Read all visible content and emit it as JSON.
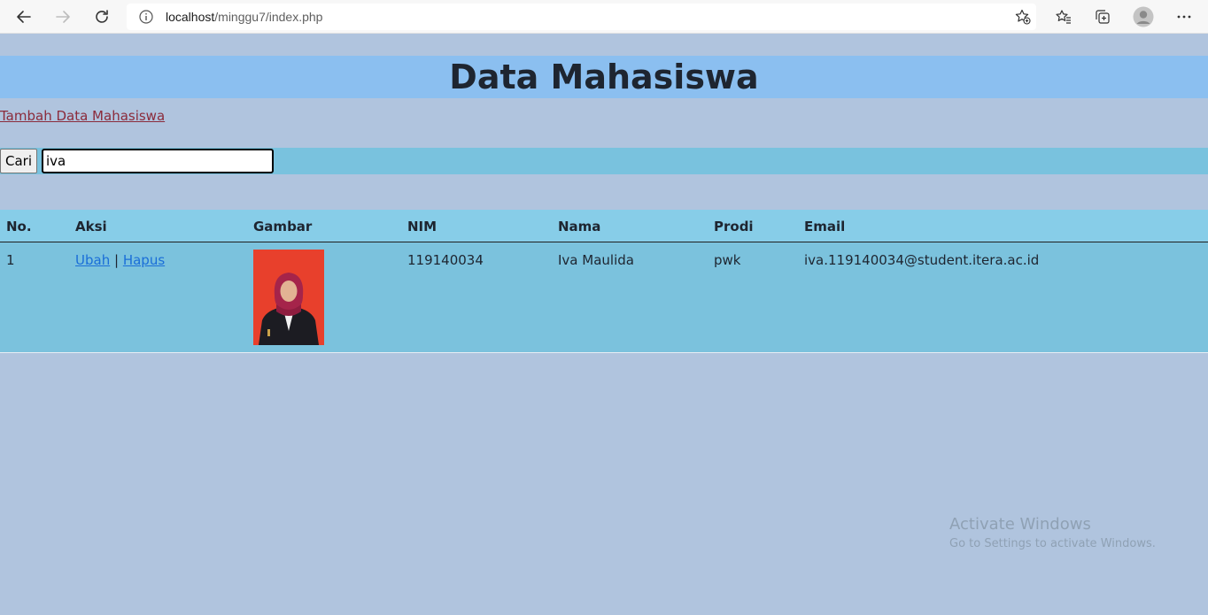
{
  "browser": {
    "url_host": "localhost",
    "url_path": "/minggu7/index.php"
  },
  "page": {
    "title": "Data Mahasiswa",
    "add_link": "Tambah Data Mahasiswa",
    "search": {
      "button_label": "Cari",
      "value": "iva"
    }
  },
  "table": {
    "headers": [
      "No.",
      "Aksi",
      "Gambar",
      "NIM",
      "Nama",
      "Prodi",
      "Email"
    ],
    "rows": [
      {
        "no": "1",
        "edit": "Ubah",
        "separator": "|",
        "delete": "Hapus",
        "nim": "119140034",
        "nama": "Iva Maulida",
        "prodi": "pwk",
        "email": "iva.119140034@student.itera.ac.id"
      }
    ]
  },
  "watermark": {
    "line1": "Activate Windows",
    "line2": "Go to Settings to activate Windows."
  },
  "colors": {
    "page_bg": "#b0c4de",
    "title_bg": "#8bbff0",
    "search_bg": "#79c2de",
    "table_header_bg": "#87cde8",
    "table_row_bg": "#7bc2dd",
    "add_link": "#8b2b3b",
    "action_link": "#1a6ed8"
  },
  "icons": [
    "back-arrow-icon",
    "forward-arrow-icon",
    "refresh-icon",
    "info-icon",
    "favorite-add-icon",
    "favorites-icon",
    "collections-icon",
    "profile-avatar-icon",
    "more-menu-icon"
  ]
}
